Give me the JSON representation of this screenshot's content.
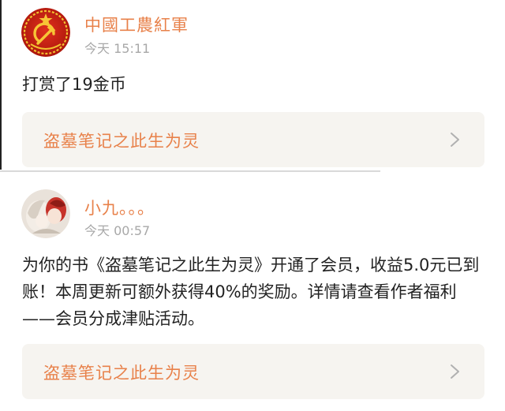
{
  "posts": [
    {
      "username": "中國工農紅軍",
      "timestamp": "今天 15:11",
      "message": "打赏了19金币",
      "book_title": "盗墓笔记之此生为灵",
      "avatar_icon": "hammer-sickle-star-emblem"
    },
    {
      "username": "小九。。。",
      "timestamp": "今天 00:57",
      "message": "为你的书《盗墓笔记之此生为灵》开通了会员，收益5.0元已到账！本周更新可额外获得40%的奖励。详情请查看作者福利——会员分成津贴活动。",
      "book_title": "盗墓笔记之此生为灵",
      "avatar_icon": "anime-character-avatar"
    }
  ],
  "colors": {
    "accent": "#e8814a",
    "text": "#222222",
    "muted": "#a8a8a8",
    "link_bg": "#f6f4f0"
  }
}
